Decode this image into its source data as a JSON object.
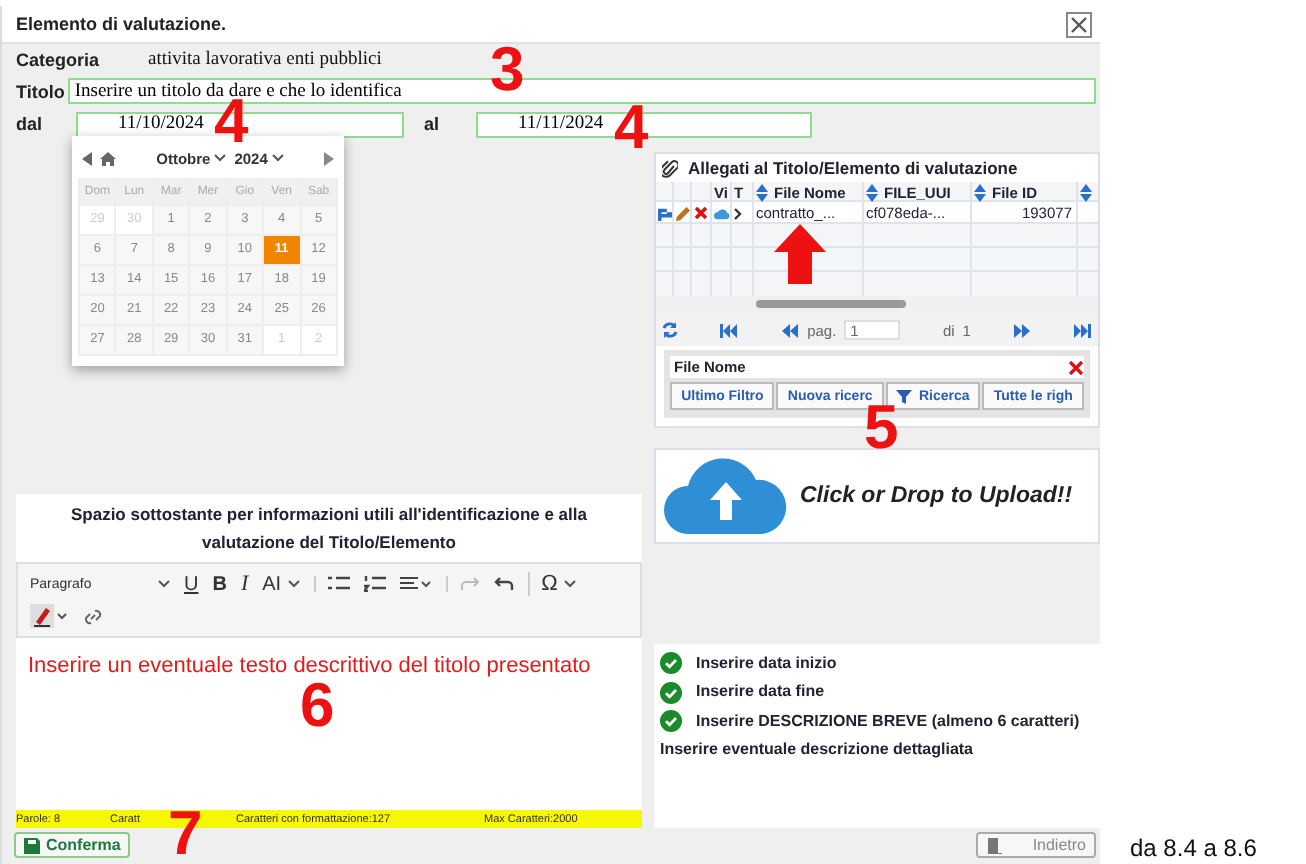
{
  "window": {
    "title": "Elemento di valutazione."
  },
  "fields": {
    "categoria": {
      "label": "Categoria",
      "value": "attivita lavorativa enti pubblici"
    },
    "titolo": {
      "label": "Titolo",
      "value": "Inserire un titolo da dare e che lo identifica"
    },
    "dal": {
      "label": "dal",
      "value": "11/10/2024"
    },
    "al": {
      "label": "al",
      "value": "11/11/2024"
    }
  },
  "datepicker": {
    "month": "Ottobre",
    "year": "2024",
    "weekdays": [
      "Dom",
      "Lun",
      "Mar",
      "Mer",
      "Gio",
      "Ven",
      "Sab"
    ],
    "weeks": [
      [
        {
          "day": "29",
          "other_month": true,
          "selected": false
        },
        {
          "day": "30",
          "other_month": true,
          "selected": false
        },
        {
          "day": "1",
          "other_month": false,
          "selected": false
        },
        {
          "day": "2",
          "other_month": false,
          "selected": false
        },
        {
          "day": "3",
          "other_month": false,
          "selected": false
        },
        {
          "day": "4",
          "other_month": false,
          "selected": false
        },
        {
          "day": "5",
          "other_month": false,
          "selected": false
        }
      ],
      [
        {
          "day": "6",
          "other_month": false,
          "selected": false
        },
        {
          "day": "7",
          "other_month": false,
          "selected": false
        },
        {
          "day": "8",
          "other_month": false,
          "selected": false
        },
        {
          "day": "9",
          "other_month": false,
          "selected": false
        },
        {
          "day": "10",
          "other_month": false,
          "selected": false
        },
        {
          "day": "11",
          "other_month": false,
          "selected": true
        },
        {
          "day": "12",
          "other_month": false,
          "selected": false
        }
      ],
      [
        {
          "day": "13",
          "other_month": false,
          "selected": false
        },
        {
          "day": "14",
          "other_month": false,
          "selected": false
        },
        {
          "day": "15",
          "other_month": false,
          "selected": false
        },
        {
          "day": "16",
          "other_month": false,
          "selected": false
        },
        {
          "day": "17",
          "other_month": false,
          "selected": false
        },
        {
          "day": "18",
          "other_month": false,
          "selected": false
        },
        {
          "day": "19",
          "other_month": false,
          "selected": false
        }
      ],
      [
        {
          "day": "20",
          "other_month": false,
          "selected": false
        },
        {
          "day": "21",
          "other_month": false,
          "selected": false
        },
        {
          "day": "22",
          "other_month": false,
          "selected": false
        },
        {
          "day": "23",
          "other_month": false,
          "selected": false
        },
        {
          "day": "24",
          "other_month": false,
          "selected": false
        },
        {
          "day": "25",
          "other_month": false,
          "selected": false
        },
        {
          "day": "26",
          "other_month": false,
          "selected": false
        }
      ],
      [
        {
          "day": "27",
          "other_month": false,
          "selected": false
        },
        {
          "day": "28",
          "other_month": false,
          "selected": false
        },
        {
          "day": "29",
          "other_month": false,
          "selected": false
        },
        {
          "day": "30",
          "other_month": false,
          "selected": false
        },
        {
          "day": "31",
          "other_month": false,
          "selected": false
        },
        {
          "day": "1",
          "other_month": true,
          "selected": false
        },
        {
          "day": "2",
          "other_month": true,
          "selected": false
        }
      ]
    ]
  },
  "attachments": {
    "title": "Allegati al Titolo/Elemento di valutazione",
    "columns": [
      {
        "label": "Vi",
        "sortable": false
      },
      {
        "label": "T",
        "sortable": false
      },
      {
        "label": "File Nome",
        "sortable": true
      },
      {
        "label": "FILE_UUI",
        "sortable": true
      },
      {
        "label": "File ID",
        "sortable": true
      }
    ],
    "rows": [
      {
        "file_nome": "contratto_...",
        "file_uuid": "cf078eda-...",
        "file_id": "193077"
      }
    ],
    "pager": {
      "page_label": "pag.",
      "page": "1",
      "of_label": "di",
      "pages": "1"
    },
    "filter": {
      "label": "File Nome"
    },
    "buttons": [
      {
        "kind": "text",
        "label": "Ultimo Filtro"
      },
      {
        "kind": "text",
        "label": "Nuova ricerc"
      },
      {
        "kind": "filter",
        "label": "Ricerca"
      },
      {
        "kind": "text",
        "label": "Tutte le righ"
      }
    ]
  },
  "upload": {
    "text": "Click or Drop to Upload!!"
  },
  "description": {
    "heading": "Spazio sottostante per informazioni utili all'identificazione e alla valutazione del Titolo/Elemento",
    "toolbar": [
      {
        "kind": "dropdown",
        "label": "Paragrafo"
      },
      {
        "kind": "underline",
        "label": "U"
      },
      {
        "kind": "bold",
        "label": "B"
      },
      {
        "kind": "italic",
        "label": "I"
      },
      {
        "kind": "size",
        "label": "AI"
      },
      {
        "kind": "bullets"
      },
      {
        "kind": "numbers"
      },
      {
        "kind": "align"
      },
      {
        "kind": "redo"
      },
      {
        "kind": "undo"
      },
      {
        "kind": "special",
        "label": "Ω"
      },
      {
        "kind": "pen"
      },
      {
        "kind": "link"
      }
    ],
    "text": "Inserire un eventuale testo descrittivo del titolo presentato",
    "counters": [
      "Parole: 8",
      "Caratt",
      "Caratteri con formattazione:127",
      "Max Caratteri:2000"
    ]
  },
  "checklist": [
    {
      "text": "Inserire data inizio",
      "done": true
    },
    {
      "text": "Inserire data fine",
      "done": true
    },
    {
      "text": "Inserire **DESCRIZIONE BREVE** (almeno 6 caratteri)",
      "done": true
    },
    {
      "text": "Inserire eventuale descrizione dettagliata",
      "done": false
    }
  ],
  "confirm_button": "Conferma",
  "back_button": "Indietro",
  "annotations": [
    "3",
    "4",
    "4",
    "5",
    "6",
    "7"
  ],
  "caption": "da 8.4 a 8.6"
}
